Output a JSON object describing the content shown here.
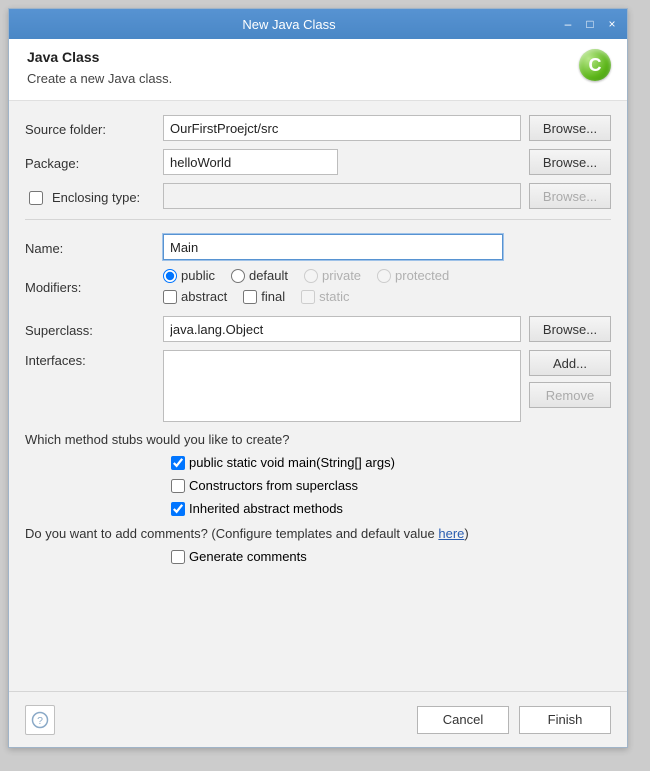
{
  "window": {
    "title": "New Java Class"
  },
  "header": {
    "heading": "Java Class",
    "subheading": "Create a new Java class."
  },
  "form": {
    "sourceFolder": {
      "label": "Source folder:",
      "value": "OurFirstProejct/src",
      "browse": "Browse..."
    },
    "package": {
      "label": "Package:",
      "value": "helloWorld",
      "browse": "Browse..."
    },
    "enclosing": {
      "label": "Enclosing type:",
      "value": "",
      "browse": "Browse...",
      "checked": false
    },
    "name": {
      "label": "Name:",
      "value": "Main"
    },
    "modifiers": {
      "label": "Modifiers:",
      "vis": {
        "public": "public",
        "default": "default",
        "private": "private",
        "protected": "protected"
      },
      "flags": {
        "abstract": "abstract",
        "final": "final",
        "static": "static"
      }
    },
    "superclass": {
      "label": "Superclass:",
      "value": "java.lang.Object",
      "browse": "Browse..."
    },
    "interfaces": {
      "label": "Interfaces:",
      "add": "Add...",
      "remove": "Remove"
    },
    "stubs": {
      "question": "Which method stubs would you like to create?",
      "main": "public static void main(String[] args)",
      "constructors": "Constructors from superclass",
      "inherited": "Inherited abstract methods"
    },
    "comments": {
      "question_prefix": "Do you want to add comments? (Configure templates and default value ",
      "here": "here",
      "question_suffix": ")",
      "generate": "Generate comments"
    }
  },
  "footer": {
    "cancel": "Cancel",
    "finish": "Finish"
  }
}
